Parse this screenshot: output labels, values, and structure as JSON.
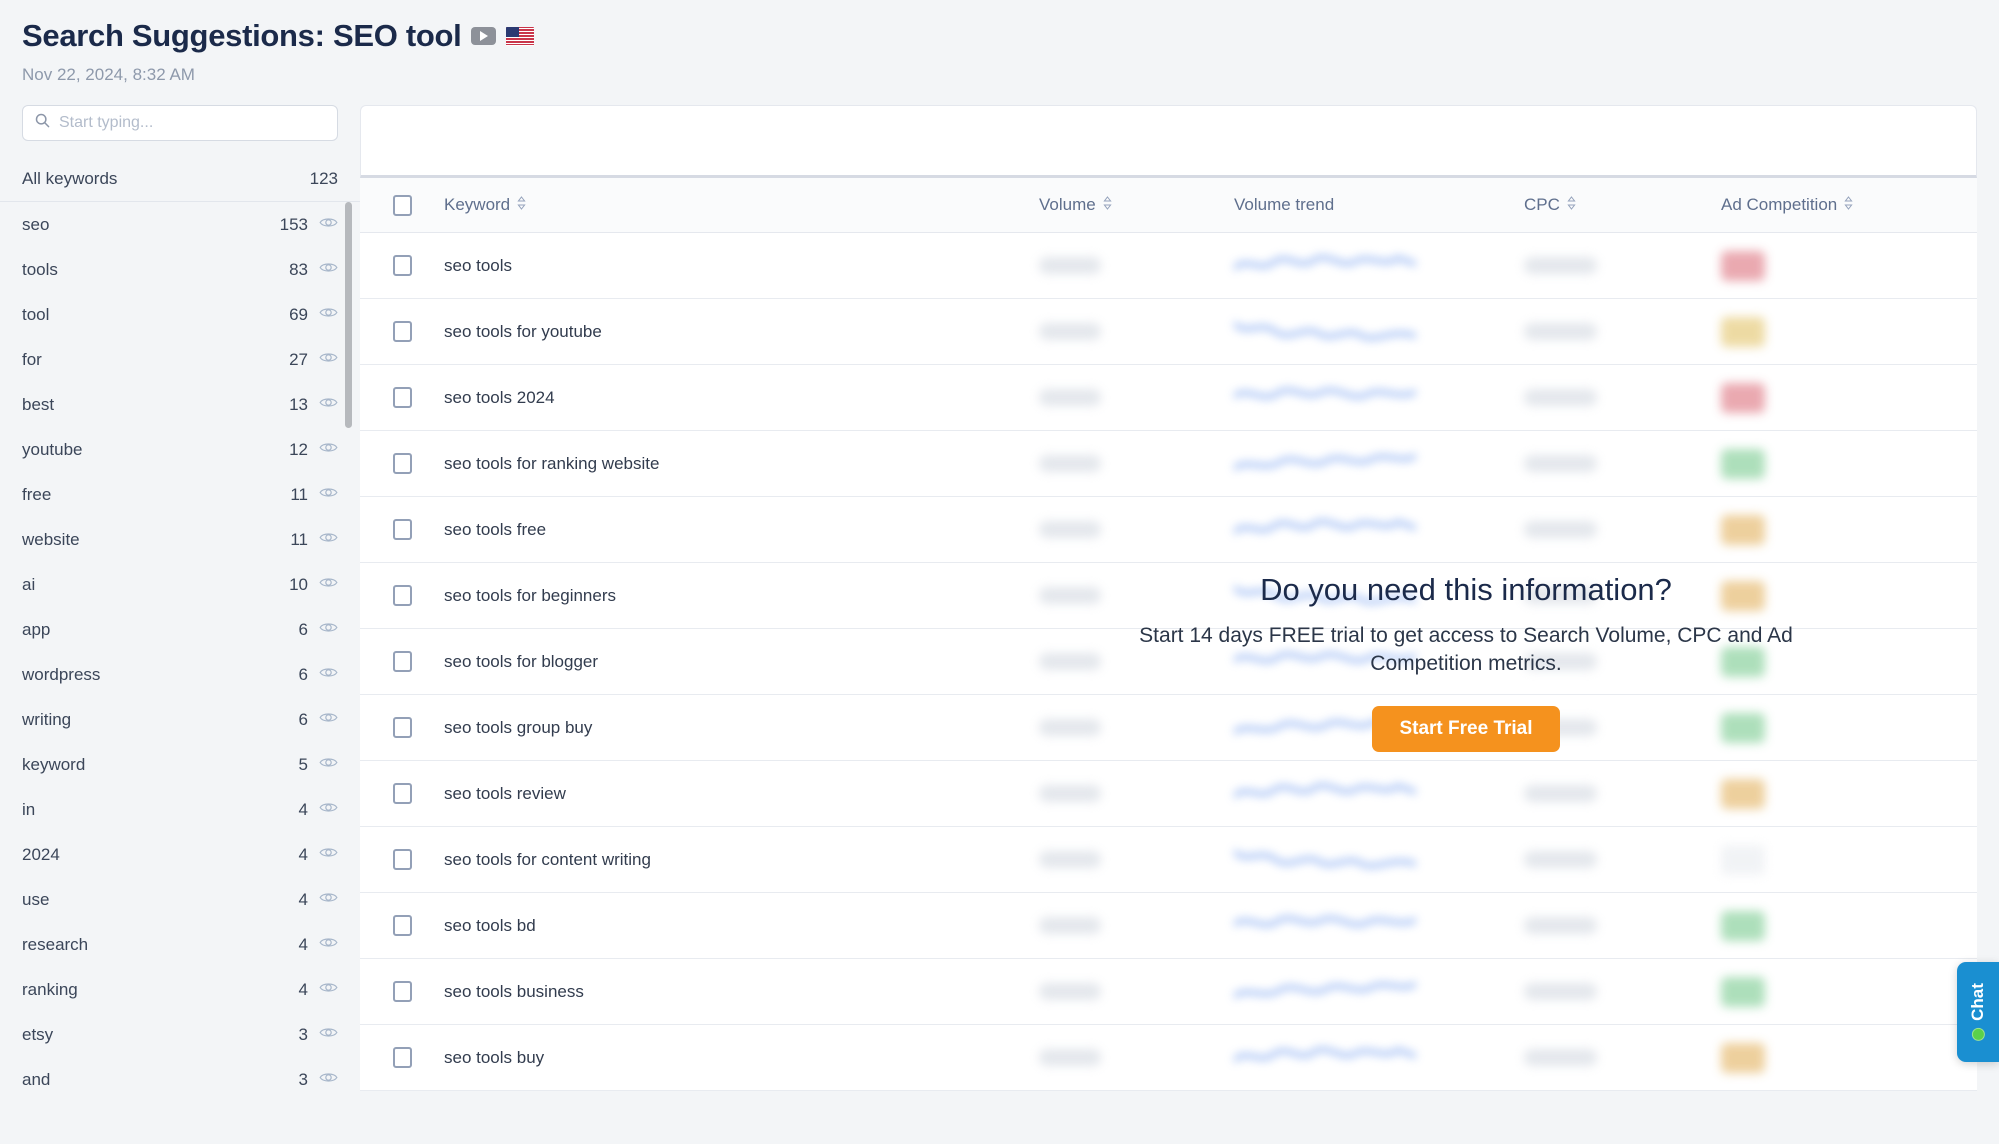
{
  "header": {
    "title": "Search Suggestions: SEO tool",
    "source_icon": "youtube-icon",
    "country_icon": "us-flag-icon",
    "timestamp": "Nov 22, 2024, 8:32 AM"
  },
  "sidebar": {
    "search": {
      "placeholder": "Start typing...",
      "value": "",
      "icon": "search-icon"
    },
    "all_keywords": {
      "label": "All keywords",
      "count": "123"
    },
    "keywords": [
      {
        "label": "seo",
        "count": "153"
      },
      {
        "label": "tools",
        "count": "83"
      },
      {
        "label": "tool",
        "count": "69"
      },
      {
        "label": "for",
        "count": "27"
      },
      {
        "label": "best",
        "count": "13"
      },
      {
        "label": "youtube",
        "count": "12"
      },
      {
        "label": "free",
        "count": "11"
      },
      {
        "label": "website",
        "count": "11"
      },
      {
        "label": "ai",
        "count": "10"
      },
      {
        "label": "app",
        "count": "6"
      },
      {
        "label": "wordpress",
        "count": "6"
      },
      {
        "label": "writing",
        "count": "6"
      },
      {
        "label": "keyword",
        "count": "5"
      },
      {
        "label": "in",
        "count": "4"
      },
      {
        "label": "2024",
        "count": "4"
      },
      {
        "label": "use",
        "count": "4"
      },
      {
        "label": "research",
        "count": "4"
      },
      {
        "label": "ranking",
        "count": "4"
      },
      {
        "label": "etsy",
        "count": "3"
      },
      {
        "label": "and",
        "count": "3"
      }
    ]
  },
  "table": {
    "columns": [
      {
        "key": "check",
        "label": "",
        "sortable": false
      },
      {
        "key": "keyword",
        "label": "Keyword",
        "sortable": true
      },
      {
        "key": "volume",
        "label": "Volume",
        "sortable": true
      },
      {
        "key": "trend",
        "label": "Volume trend",
        "sortable": false
      },
      {
        "key": "cpc",
        "label": "CPC",
        "sortable": true
      },
      {
        "key": "adcomp",
        "label": "Ad Competition",
        "sortable": true
      }
    ],
    "rows": [
      {
        "keyword": "seo tools",
        "adcomp_color": "#e8a0a8"
      },
      {
        "keyword": "seo tools for youtube",
        "adcomp_color": "#ecd79a"
      },
      {
        "keyword": "seo tools 2024",
        "adcomp_color": "#e8a0a8"
      },
      {
        "keyword": "seo tools for ranking website",
        "adcomp_color": "#a5dcb4"
      },
      {
        "keyword": "seo tools free",
        "adcomp_color": "#eccb93"
      },
      {
        "keyword": "seo tools for beginners",
        "adcomp_color": "#eccb93"
      },
      {
        "keyword": "seo tools for blogger",
        "adcomp_color": "#a5dcb4"
      },
      {
        "keyword": "seo tools group buy",
        "adcomp_color": "#a5dcb4"
      },
      {
        "keyword": "seo tools review",
        "adcomp_color": "#eccb93"
      },
      {
        "keyword": "seo tools for content writing",
        "adcomp_color": "#f0f2f5"
      },
      {
        "keyword": "seo tools bd",
        "adcomp_color": "#a5dcb4"
      },
      {
        "keyword": "seo tools business",
        "adcomp_color": "#a5dcb4"
      },
      {
        "keyword": "seo tools buy",
        "adcomp_color": "#eccb93"
      }
    ]
  },
  "cta": {
    "title": "Do you need this information?",
    "subtitle": "Start 14 days FREE trial to get access to Search Volume, CPC and Ad Competition metrics.",
    "button_label": "Start Free Trial",
    "button_color": "#f5921e"
  },
  "chat": {
    "label": "Chat",
    "status_color": "#5bd14b",
    "widget_color": "#1a8fd1"
  }
}
